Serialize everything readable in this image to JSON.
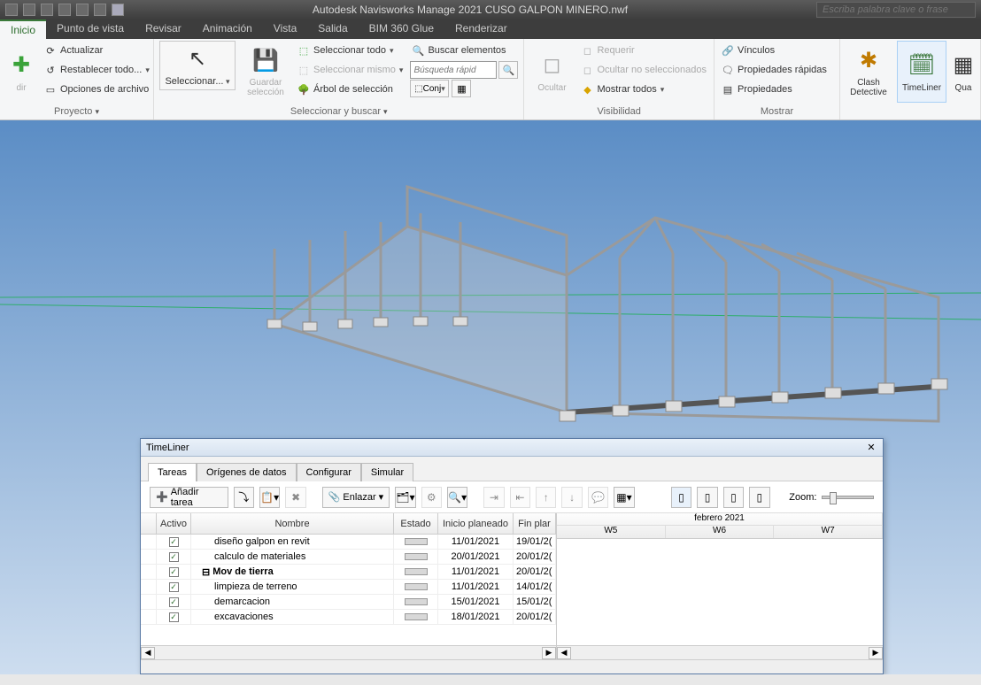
{
  "app": {
    "title": "Autodesk Navisworks Manage 2021   CUSO GALPON MINERO.nwf",
    "search_placeholder": "Escriba palabra clave o frase"
  },
  "tabs": {
    "inicio": "Inicio",
    "punto": "Punto de vista",
    "revisar": "Revisar",
    "animacion": "Animación",
    "vista": "Vista",
    "salida": "Salida",
    "bim": "BIM 360 Glue",
    "render": "Renderizar"
  },
  "ribbon": {
    "proyecto": {
      "label": "Proyecto",
      "actualizar": "Actualizar",
      "restablecer": "Restablecer todo...",
      "opciones": "Opciones de archivo",
      "nadir": "dir"
    },
    "seleccionar": {
      "label": "Seleccionar y buscar",
      "seleccionar": "Seleccionar...",
      "guardar": "Guardar\nselección",
      "sel_todo": "Seleccionar todo",
      "sel_mismo": "Seleccionar mismo",
      "arbol": "Árbol de selección",
      "buscar_elem": "Buscar elementos",
      "busqueda_ph": "Búsqueda rápid",
      "conj": "Conj"
    },
    "visibilidad": {
      "label": "Visibilidad",
      "ocultar": "Ocultar",
      "requerir": "Requerir",
      "ocultar_no": "Ocultar no seleccionados",
      "mostrar_todos": "Mostrar todos"
    },
    "mostrar": {
      "label": "Mostrar",
      "vinculos": "Vínculos",
      "prop_rapidas": "Propiedades rápidas",
      "propiedades": "Propiedades"
    },
    "herramientas": {
      "clash": "Clash\nDetective",
      "timeliner": "TimeLiner",
      "qua": "Qua"
    }
  },
  "timeliner": {
    "title": "TimeLiner",
    "tabs": {
      "tareas": "Tareas",
      "origenes": "Orígenes de datos",
      "configurar": "Configurar",
      "simular": "Simular"
    },
    "toolbar": {
      "anadir": "Añadir tarea",
      "enlazar": "Enlazar",
      "zoom": "Zoom:"
    },
    "columns": {
      "activo": "Activo",
      "nombre": "Nombre",
      "estado": "Estado",
      "inicio": "Inicio planeado",
      "fin": "Fin plar"
    },
    "gantt": {
      "month": "febrero 2021",
      "weeks": [
        "W5",
        "W6",
        "W7"
      ]
    },
    "rows": [
      {
        "activo": true,
        "nombre": "diseño galpon en revit",
        "inicio": "11/01/2021",
        "fin": "19/01/2(",
        "bold": false,
        "indent": 1
      },
      {
        "activo": true,
        "nombre": "calculo de materiales",
        "inicio": "20/01/2021",
        "fin": "20/01/2(",
        "bold": false,
        "indent": 1
      },
      {
        "activo": true,
        "nombre": "Mov de tierra",
        "inicio": "11/01/2021",
        "fin": "20/01/2(",
        "bold": true,
        "indent": 0,
        "exp": true
      },
      {
        "activo": true,
        "nombre": "limpieza de terreno",
        "inicio": "11/01/2021",
        "fin": "14/01/2(",
        "bold": false,
        "indent": 1
      },
      {
        "activo": true,
        "nombre": "demarcacion",
        "inicio": "15/01/2021",
        "fin": "15/01/2(",
        "bold": false,
        "indent": 1
      },
      {
        "activo": true,
        "nombre": "excavaciones",
        "inicio": "18/01/2021",
        "fin": "20/01/2(",
        "bold": false,
        "indent": 1
      }
    ]
  }
}
